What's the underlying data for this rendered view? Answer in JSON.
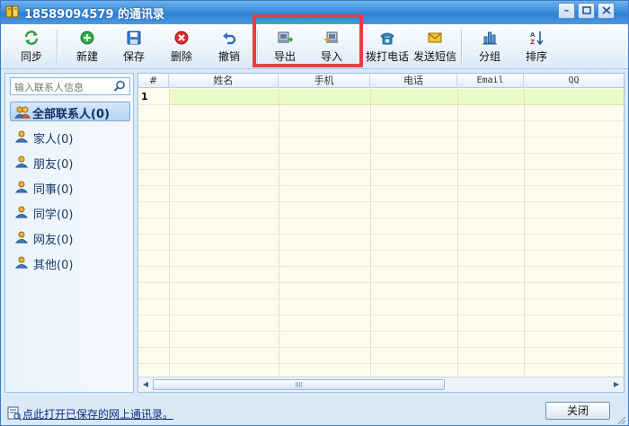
{
  "window": {
    "title": "18589094579 的通讯录",
    "minimize_glyph": "–",
    "app_icon": "address-book-icon"
  },
  "toolbar": {
    "items": [
      {
        "id": "sync",
        "label": "同步",
        "icon": "sync-icon"
      },
      {
        "id": "new",
        "label": "新建",
        "icon": "add-icon"
      },
      {
        "id": "save",
        "label": "保存",
        "icon": "save-icon"
      },
      {
        "id": "delete",
        "label": "删除",
        "icon": "delete-icon"
      },
      {
        "id": "undo",
        "label": "撤销",
        "icon": "undo-icon"
      },
      {
        "id": "export",
        "label": "导出",
        "icon": "export-icon"
      },
      {
        "id": "import",
        "label": "导入",
        "icon": "import-icon"
      },
      {
        "id": "call",
        "label": "拨打电话",
        "icon": "phone-icon"
      },
      {
        "id": "sms",
        "label": "发送短信",
        "icon": "envelope-icon"
      },
      {
        "id": "group",
        "label": "分组",
        "icon": "group-chart-icon"
      },
      {
        "id": "sort",
        "label": "排序",
        "icon": "sort-az-icon"
      }
    ],
    "highlight_color": "#e4403f"
  },
  "sidebar": {
    "search_placeholder": "输入联系人信息",
    "all_contacts": "全部联系人(0)",
    "groups": [
      {
        "label": "家人(0)"
      },
      {
        "label": "朋友(0)"
      },
      {
        "label": "同事(0)"
      },
      {
        "label": "同学(0)"
      },
      {
        "label": "网友(0)"
      },
      {
        "label": "其他(0)"
      }
    ]
  },
  "grid": {
    "columns": [
      "#",
      "姓名",
      "手机",
      "电话",
      "Email",
      "QQ"
    ],
    "rows": [
      {
        "num": "1"
      }
    ],
    "selected_row_color": "#eafbc6"
  },
  "footer": {
    "link_text": "点此打开已保存的网上通讯录。",
    "close_label": "关闭"
  },
  "colors": {
    "title_bar": "#3b8ddc",
    "window_bg": "#dbe9f7",
    "grid_bg": "#fffcee"
  }
}
